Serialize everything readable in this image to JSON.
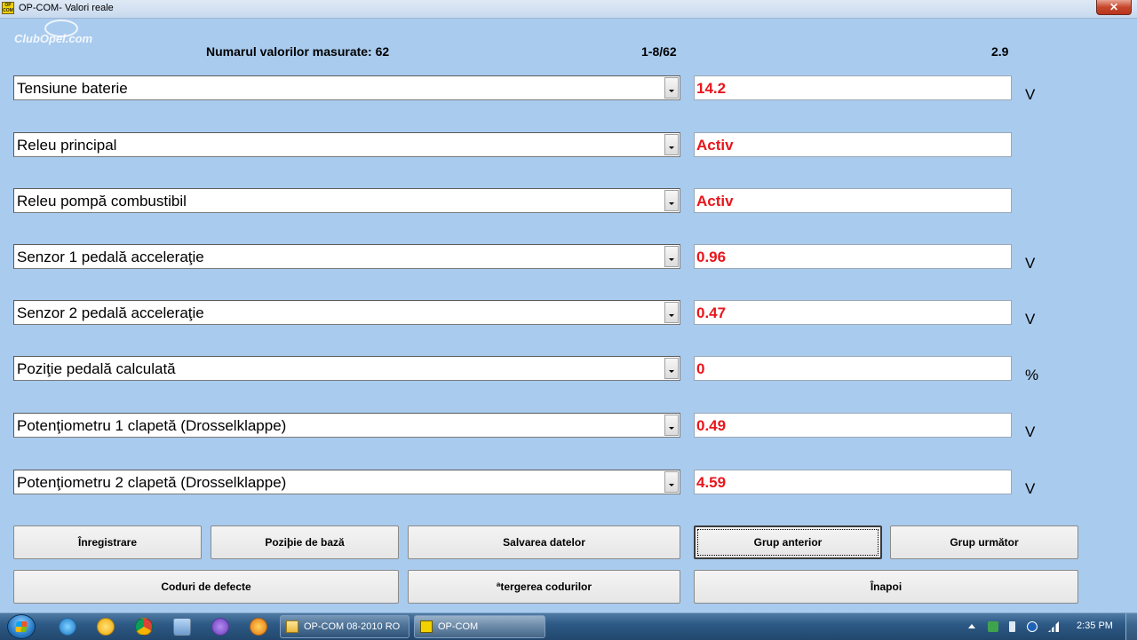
{
  "window": {
    "title": "OP-COM- Valori reale",
    "app_icon_text": "OP COM",
    "close_label": "✕"
  },
  "logo": {
    "text": "ClubOpel.com"
  },
  "header": {
    "measured_label": "Numarul valorilor masurate: 62",
    "range": "1-8/62",
    "version": "2.9"
  },
  "rows": [
    {
      "param": "Tensiune baterie",
      "value": "14.2",
      "unit": "V"
    },
    {
      "param": "Releu principal",
      "value": "Activ",
      "unit": ""
    },
    {
      "param": "Releu pompă combustibil",
      "value": "Activ",
      "unit": ""
    },
    {
      "param": "Senzor 1 pedală acceleraţie",
      "value": "0.96",
      "unit": "V"
    },
    {
      "param": "Senzor 2 pedală acceleraţie",
      "value": "0.47",
      "unit": "V"
    },
    {
      "param": "Poziţie pedală calculată",
      "value": "0",
      "unit": "%"
    },
    {
      "param": "Potenţiometru 1 clapetă (Drosselklappe)",
      "value": "0.49",
      "unit": "V"
    },
    {
      "param": "Potenţiometru 2 clapetă (Drosselklappe)",
      "value": "4.59",
      "unit": "V"
    }
  ],
  "buttons": {
    "record": "Înregistrare",
    "base_position": "Poziþie de bază",
    "save_data": "Salvarea datelor",
    "prev_group": "Grup anterior",
    "next_group": "Grup următor",
    "fault_codes": "Coduri de defecte",
    "clear_codes": "ªtergerea codurilor",
    "back": "Înapoi"
  },
  "taskbar": {
    "tasks": [
      {
        "label": "OP-COM 08-2010 RO",
        "icon": "folder-icon"
      },
      {
        "label": "OP-COM",
        "icon": "opcom-app-icon"
      }
    ],
    "pinned": [
      "internet-explorer-icon",
      "messenger-icon",
      "chrome-icon",
      "chat-icon",
      "viber-icon",
      "firefox-icon"
    ],
    "clock": "2:35 PM"
  },
  "colors": {
    "background": "#a9cbee",
    "value_text": "#e8161c"
  }
}
